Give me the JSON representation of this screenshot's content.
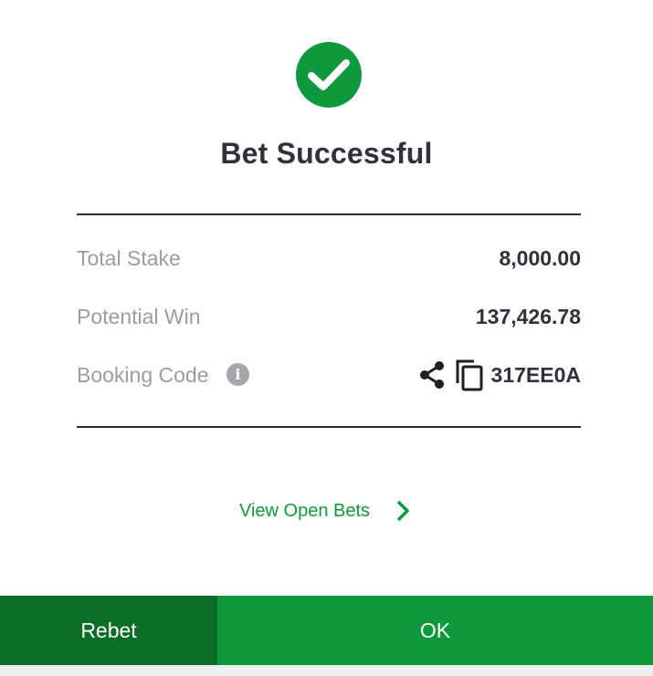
{
  "modal": {
    "title": "Bet Successful",
    "rows": {
      "total_stake": {
        "label": "Total Stake",
        "value": "8,000.00"
      },
      "potential_win": {
        "label": "Potential Win",
        "value": "137,426.78"
      },
      "booking_code": {
        "label": "Booking Code",
        "value": "317EE0A"
      }
    },
    "link_view_open_bets": "View Open Bets",
    "buttons": {
      "rebet": "Rebet",
      "ok": "OK"
    },
    "icons": {
      "status": "check-circle-icon",
      "info": "info-icon",
      "share": "share-icon",
      "copy": "copy-icon",
      "link_arrow": "chevron-right-icon"
    }
  },
  "colors": {
    "accent_green": "#0e9a3c",
    "dark_green": "#0b6d26",
    "text_dark": "#2f323b",
    "text_muted": "#9a9ba3"
  }
}
